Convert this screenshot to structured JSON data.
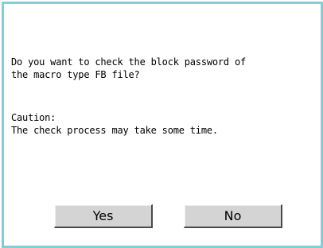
{
  "dialog": {
    "question_line1": "Do you want to check the block password of",
    "question_line2": "the macro type FB file?",
    "caution_label": "Caution:",
    "caution_text": "The check process may take some time.",
    "buttons": {
      "yes_label": "Yes",
      "no_label": "No"
    }
  },
  "colors": {
    "border": "#7fcfd6",
    "button_face": "#d4d4d4",
    "button_shadow": "#4a4a4a"
  }
}
